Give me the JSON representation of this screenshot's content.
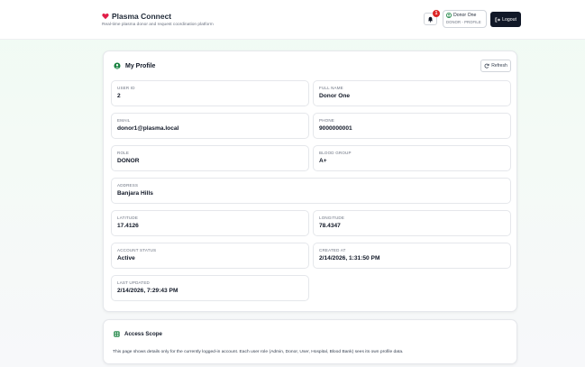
{
  "header": {
    "brand_title": "Plasma Connect",
    "brand_subtitle": "Real-time plasma donor and request coordination platform",
    "notification_count": "1",
    "user_name": "Donor One",
    "user_role": "DONOR - PROFILE",
    "logout_label": "Logout"
  },
  "profile": {
    "title": "My Profile",
    "refresh_label": "Refresh",
    "fields": {
      "user_id": {
        "label": "USER ID",
        "value": "2"
      },
      "full_name": {
        "label": "FULL NAME",
        "value": "Donor One"
      },
      "email": {
        "label": "EMAIL",
        "value": "donor1@plasma.local"
      },
      "phone": {
        "label": "PHONE",
        "value": "9000000001"
      },
      "role": {
        "label": "ROLE",
        "value": "DONOR"
      },
      "blood_group": {
        "label": "BLOOD GROUP",
        "value": "A+"
      },
      "address": {
        "label": "ADDRESS",
        "value": "Banjara Hills"
      },
      "latitude": {
        "label": "LATITUDE",
        "value": "17.4126"
      },
      "longitude": {
        "label": "LONGITUDE",
        "value": "78.4347"
      },
      "account_status": {
        "label": "ACCOUNT STATUS",
        "value": "Active"
      },
      "created_at": {
        "label": "CREATED AT",
        "value": "2/14/2026, 1:31:50 PM"
      },
      "last_updated": {
        "label": "LAST UPDATED",
        "value": "2/14/2026, 7:29:43 PM"
      }
    }
  },
  "access": {
    "title": "Access Scope",
    "text": "This page shows details only for the currently logged-in account. Each user role (Admin, Donor, User, Hospital, Blood Bank) sees its own profile data."
  },
  "icons": {
    "brand": "heart-icon",
    "bell": "bell-icon",
    "user": "user-circle-icon",
    "logout": "logout-icon",
    "profile": "user-circle-icon",
    "refresh": "refresh-icon",
    "access": "grid-icon"
  },
  "colors": {
    "brand_green": "#15803d",
    "brand_heart": "#e11d48",
    "badge_red": "#dc2626",
    "logout_bg": "#111827"
  }
}
